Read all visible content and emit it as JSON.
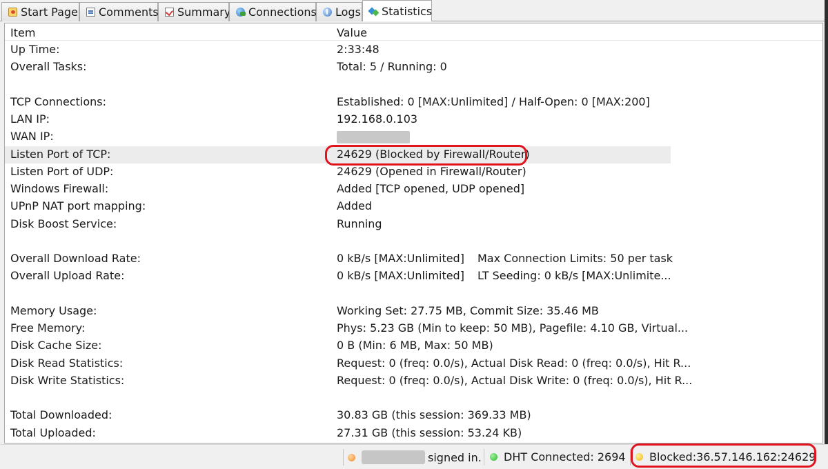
{
  "tabs": [
    {
      "label": "Start Page",
      "icon": "start-page-icon"
    },
    {
      "label": "Comments",
      "icon": "comments-icon"
    },
    {
      "label": "Summary",
      "icon": "summary-icon"
    },
    {
      "label": "Connections",
      "icon": "connections-icon"
    },
    {
      "label": "Logs",
      "icon": "logs-icon"
    },
    {
      "label": "Statistics",
      "icon": "statistics-icon",
      "active": true
    }
  ],
  "table": {
    "columns": [
      "Item",
      "Value"
    ],
    "rows": [
      {
        "item": "Up Time:",
        "value": "2:33:48",
        "value2": ""
      },
      {
        "item": "Overall Tasks:",
        "value": "Total: 5 / Running: 0",
        "value2": ""
      },
      {
        "item": "",
        "value": "",
        "value2": ""
      },
      {
        "item": "TCP Connections:",
        "value": "Established: 0 [MAX:Unlimited] / Half-Open: 0 [MAX:200]",
        "value2": ""
      },
      {
        "item": "LAN IP:",
        "value": "192.168.0.103",
        "value2": ""
      },
      {
        "item": "WAN IP:",
        "value": "",
        "value2": "",
        "redacted": true
      },
      {
        "item": "Listen Port of TCP:",
        "value": "24629 (Blocked by Firewall/Router)",
        "value2": "",
        "highlighted": true
      },
      {
        "item": "Listen Port of UDP:",
        "value": "24629 (Opened in Firewall/Router)",
        "value2": ""
      },
      {
        "item": "Windows Firewall:",
        "value": "Added [TCP opened, UDP opened]",
        "value2": ""
      },
      {
        "item": "UPnP NAT port mapping:",
        "value": "Added",
        "value2": ""
      },
      {
        "item": "Disk Boost Service:",
        "value": "Running",
        "value2": ""
      },
      {
        "item": "",
        "value": "",
        "value2": ""
      },
      {
        "item": "Overall Download Rate:",
        "value": "0 kB/s [MAX:Unlimited]",
        "value2": "Max Connection Limits: 50 per task"
      },
      {
        "item": "Overall Upload Rate:",
        "value": "0 kB/s [MAX:Unlimited]",
        "value2": "LT Seeding: 0 kB/s [MAX:Unlimite..."
      },
      {
        "item": "",
        "value": "",
        "value2": ""
      },
      {
        "item": "Memory Usage:",
        "value": "Working Set: 27.75 MB, Commit Size: 35.46 MB",
        "value2": ""
      },
      {
        "item": "Free Memory:",
        "value": "Phys: 5.23 GB (Min to keep: 50 MB), Pagefile: 4.10 GB, Virtual...",
        "value2": ""
      },
      {
        "item": "Disk Cache Size:",
        "value": "0 B (Min: 6 MB, Max: 50 MB)",
        "value2": ""
      },
      {
        "item": "Disk Read Statistics:",
        "value": "Request: 0 (freq: 0.0/s), Actual Disk Read: 0 (freq: 0.0/s), Hit R...",
        "value2": ""
      },
      {
        "item": "Disk Write Statistics:",
        "value": "Request: 0 (freq: 0.0/s), Actual Disk Write: 0 (freq: 0.0/s), Hit R...",
        "value2": ""
      },
      {
        "item": "",
        "value": "",
        "value2": ""
      },
      {
        "item": "Total Downloaded:",
        "value": "30.83 GB (this session: 369.33 MB)",
        "value2": ""
      },
      {
        "item": "Total Uploaded:",
        "value": "27.31 GB (this session: 53.24 KB)",
        "value2": ""
      }
    ]
  },
  "status": {
    "signed_in_text": "signed in.",
    "dht_text": "DHT Connected: 2694",
    "blocked_text": "Blocked:36.57.146.162:24629"
  },
  "colors": {
    "annotation_ring": "#e0141e",
    "signed_in_dot": "#f08a24",
    "dht_dot": "#1fb81f",
    "blocked_dot": "#f2b807"
  }
}
